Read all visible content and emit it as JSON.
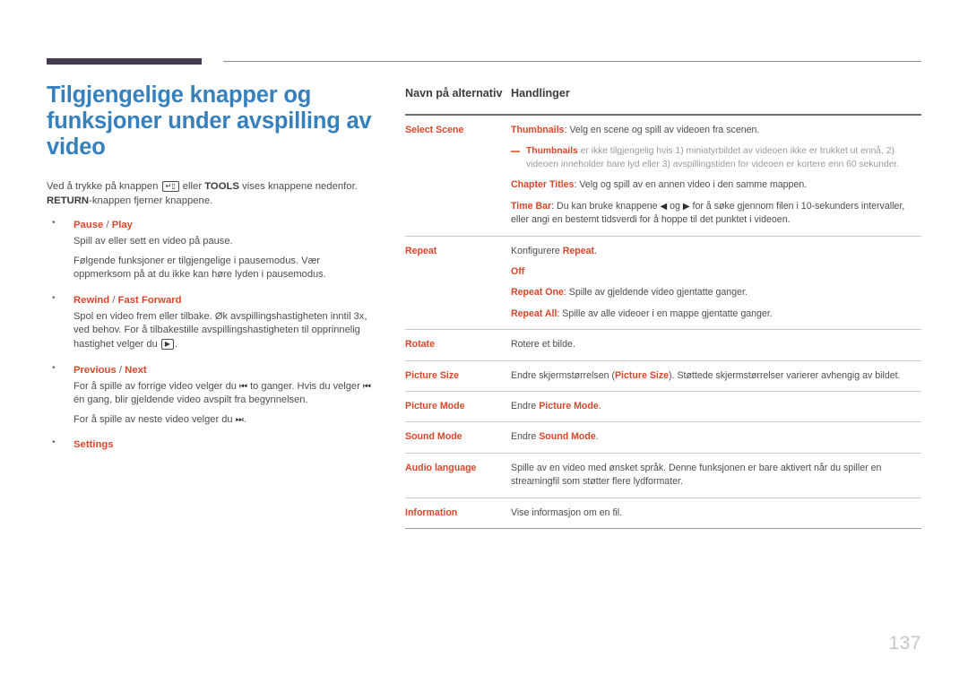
{
  "colors": {
    "heading_blue": "#3580bd",
    "accent_orange": "#d9472b",
    "rule_dark": "#453b52",
    "body_gray": "#4d4d4d",
    "note_gray": "#9a9a9a",
    "page_number_gray": "#c3c7cc"
  },
  "left": {
    "title": "Tilgjengelige knapper og funksjoner under avspilling av video",
    "intro": {
      "part1": "Ved å trykke på knappen ",
      "enter_key_icon": "enter-key-icon",
      "part2": " eller ",
      "tools": "TOOLS",
      "part3": " vises knappene nedenfor. ",
      "return": "RETURN",
      "part4": "-knappen fjerner knappene."
    },
    "bullets": [
      {
        "head_a": "Pause",
        "sep": " / ",
        "head_b": "Play",
        "paragraphs": [
          "Spill av eller sett en video på pause.",
          "Følgende funksjoner er tilgjengelige i pausemodus. Vær oppmerksom på at du ikke kan høre lyden i pausemodus."
        ]
      },
      {
        "head_a": "Rewind",
        "sep": " / ",
        "head_b": "Fast Forward",
        "paragraphs": [
          "Spol en video frem eller tilbake. Øk avspillingshastigheten inntil 3x, ved behov. For å tilbakestille avspillingshastigheten til opprinnelig hastighet velger du ",
          "."
        ],
        "play_icon": "play-icon"
      },
      {
        "head_a": "Previous",
        "sep": " / ",
        "head_b": "Next",
        "paragraphs": [
          "For å spille av forrige video velger du ",
          " to ganger. Hvis du velger ",
          " én gang, blir gjeldende video avspilt fra begynnelsen.",
          "For å spille av neste video velger du ",
          "."
        ],
        "prev_icon": "skip-previous-icon",
        "next_icon": "skip-next-icon"
      },
      {
        "head_a": "Settings",
        "sep": "",
        "head_b": "",
        "paragraphs": []
      }
    ]
  },
  "table": {
    "headers": {
      "col1": "Navn på alternativ",
      "col2": "Handlinger"
    },
    "rows": [
      {
        "name": "Select Scene",
        "blocks": [
          {
            "kind": "term_desc",
            "term": "Thumbnails",
            "text": ": Velg en scene og spill av videoen fra scenen."
          },
          {
            "kind": "note",
            "term": "Thumbnails",
            "text": " er ikke tilgjengelig hvis 1) miniatyrbildet av videoen ikke er trukket ut ennå, 2) videoen inneholder bare lyd eller 3) avspillingstiden for videoen er kortere enn 60 sekunder."
          },
          {
            "kind": "term_desc",
            "term": "Chapter Titles",
            "text": ": Velg og spill av en annen video i den samme mappen."
          },
          {
            "kind": "timebar",
            "term": "Time Bar",
            "text_a": ": Du kan bruke knappene ",
            "text_b": " og ",
            "text_c": " for å søke gjennom filen i 10-sekunders intervaller, eller angi en bestemt tidsverdi for å hoppe til det punktet i videoen.",
            "left_icon": "arrow-left-icon",
            "right_icon": "arrow-right-icon"
          }
        ]
      },
      {
        "name": "Repeat",
        "blocks": [
          {
            "kind": "plain_term_end",
            "pre": "Konfigurere ",
            "term": "Repeat",
            "text": "."
          },
          {
            "kind": "term_only",
            "term": "Off"
          },
          {
            "kind": "term_desc",
            "term": "Repeat One",
            "text": ": Spille av gjeldende video gjentatte ganger."
          },
          {
            "kind": "term_desc",
            "term": "Repeat All",
            "text": ": Spille av alle videoer i en mappe gjentatte ganger."
          }
        ]
      },
      {
        "name": "Rotate",
        "blocks": [
          {
            "kind": "plain",
            "text": "Rotere et bilde."
          }
        ]
      },
      {
        "name": "Picture Size",
        "blocks": [
          {
            "kind": "plain_term_mid",
            "pre": "Endre skjermstørrelsen (",
            "term": "Picture Size",
            "post": "). Støttede skjermstørrelser varierer avhengig av bildet."
          }
        ]
      },
      {
        "name": "Picture Mode",
        "blocks": [
          {
            "kind": "plain_term_end",
            "pre": "Endre ",
            "term": "Picture Mode",
            "text": "."
          }
        ]
      },
      {
        "name": "Sound Mode",
        "blocks": [
          {
            "kind": "plain_term_end",
            "pre": "Endre ",
            "term": "Sound Mode",
            "text": "."
          }
        ]
      },
      {
        "name": "Audio language",
        "blocks": [
          {
            "kind": "plain",
            "text": "Spille av en video med ønsket språk. Denne funksjonen er bare aktivert når du spiller en streamingfil som støtter flere lydformater."
          }
        ]
      },
      {
        "name": "Information",
        "blocks": [
          {
            "kind": "plain",
            "text": "Vise informasjon om en fil."
          }
        ]
      }
    ]
  },
  "footer": {
    "page_number": "137"
  }
}
